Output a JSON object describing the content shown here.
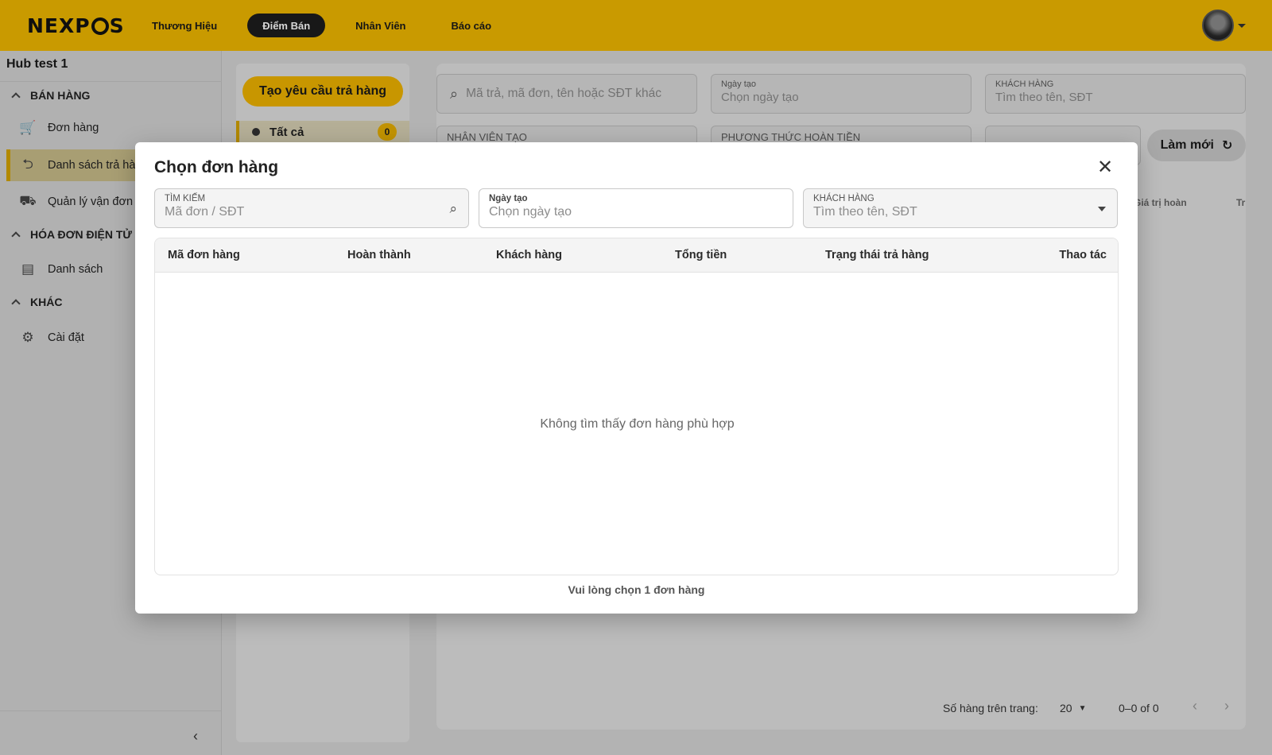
{
  "app": {
    "logo_left": "NEXP",
    "logo_right": "S"
  },
  "nav": {
    "items": [
      {
        "label": "Thương Hiệu"
      },
      {
        "label": "Điểm Bán"
      },
      {
        "label": "Nhân Viên"
      },
      {
        "label": "Báo cáo"
      }
    ]
  },
  "sidebar": {
    "hub": "Hub test 1",
    "sections": [
      {
        "title": "BÁN HÀNG"
      },
      {
        "title": "HÓA ĐƠN ĐIỆN TỬ"
      },
      {
        "title": "KHÁC"
      }
    ],
    "items": [
      {
        "label": "Đơn hàng",
        "icon": "cart-icon"
      },
      {
        "label": "Danh sách trả hàng",
        "icon": "return-box-icon"
      },
      {
        "label": "Quản lý vận đơn",
        "icon": "truck-icon"
      },
      {
        "label": "Danh sách",
        "icon": "list-icon"
      },
      {
        "label": "Cài đặt",
        "icon": "gear-icon"
      }
    ]
  },
  "midpanel": {
    "create_button": "Tạo yêu cầu trả hàng",
    "filter_all": "Tất cả",
    "filter_all_count": "0"
  },
  "main": {
    "search_placeholder": "Mã trả, mã đơn, tên hoặc SĐT khác",
    "date_label": "Ngày tạo",
    "date_placeholder": "Chọn ngày tạo",
    "customer_label": "KHÁCH HÀNG",
    "customer_placeholder": "Tìm theo tên, SĐT",
    "staff_label": "NHÂN VIÊN TẠO",
    "refund_label": "PHƯƠNG THỨC HOÀN TIỀN",
    "refresh_button": "Làm mới",
    "col_refund_value": "Giá trị hoàn",
    "col_partial": "Tr",
    "rows_per_page_label": "Số hàng trên trang:",
    "rows_per_page": "20",
    "range": "0–0 of 0"
  },
  "dialog": {
    "title": "Chọn đơn hàng",
    "search_label": "TÌM KIẾM",
    "search_placeholder": "Mã đơn / SĐT",
    "date_label": "Ngày tạo",
    "date_placeholder": "Chọn ngày tạo",
    "customer_label": "KHÁCH HÀNG",
    "customer_placeholder": "Tìm theo tên, SĐT",
    "columns": [
      "Mã đơn hàng",
      "Hoàn thành",
      "Khách hàng",
      "Tổng tiền",
      "Trạng thái trả hàng",
      "Thao tác"
    ],
    "empty_message": "Không tìm thấy đơn hàng phù hợp",
    "footer": "Vui lòng chọn 1 đơn hàng"
  },
  "colors": {
    "brand": "#f0b800",
    "active_nav": "#1d1d1d"
  }
}
